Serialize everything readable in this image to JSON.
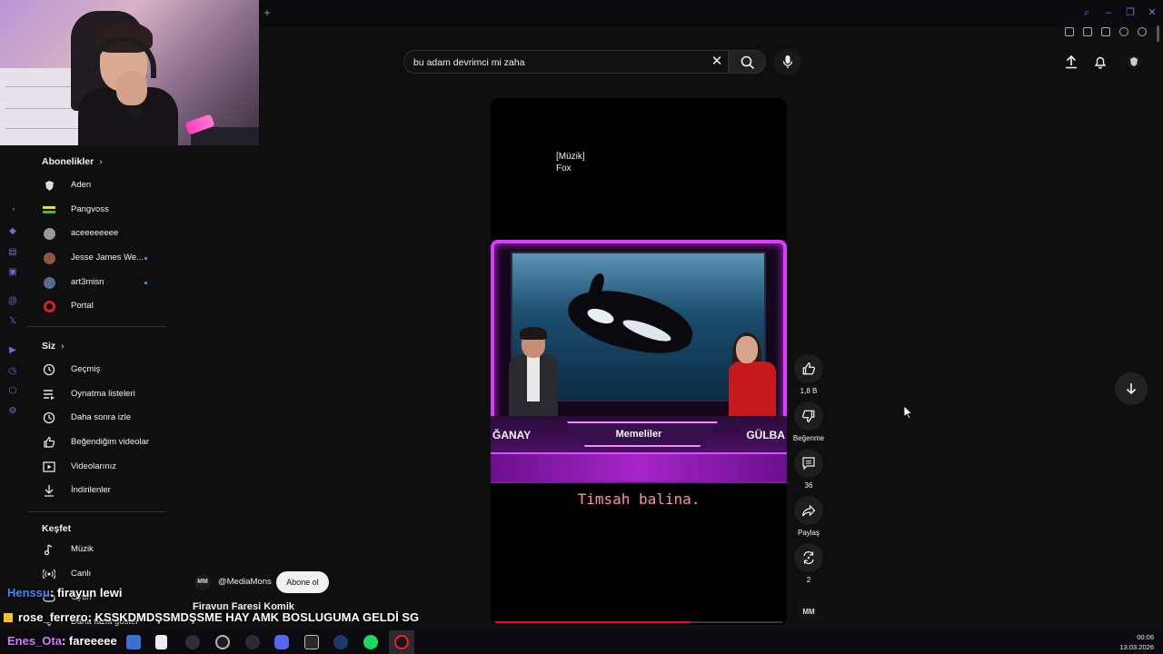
{
  "search": {
    "query": "bu adam devrimci mi zaha"
  },
  "sidebar": {
    "subscriptions_title": "Abonelikler",
    "subscriptions": [
      {
        "label": "Aden",
        "icon": "aden-avatar",
        "new": false
      },
      {
        "label": "Pangvoss",
        "icon": "pangvoss-avatar",
        "new": false
      },
      {
        "label": "aceeeeeeee",
        "icon": "aceeeeeeee-avatar",
        "new": false
      },
      {
        "label": "Jesse James We...",
        "icon": "jesse-avatar",
        "new": true
      },
      {
        "label": "art3misn",
        "icon": "art3misn-avatar",
        "new": true
      },
      {
        "label": "Portal",
        "icon": "portal-avatar",
        "new": false
      }
    ],
    "you_title": "Siz",
    "you_items": [
      {
        "label": "Geçmiş",
        "icon": "history-icon"
      },
      {
        "label": "Oynatma listeleri",
        "icon": "playlist-icon"
      },
      {
        "label": "Daha sonra izle",
        "icon": "clock-icon"
      },
      {
        "label": "Beğendiğim videolar",
        "icon": "thumbs-up-icon"
      },
      {
        "label": "Videolarınız",
        "icon": "video-icon"
      },
      {
        "label": "İndirilenler",
        "icon": "download-icon"
      }
    ],
    "explore_title": "Keşfet",
    "explore_items": [
      {
        "label": "Müzik",
        "icon": "music-icon"
      },
      {
        "label": "Canlı",
        "icon": "live-icon"
      },
      {
        "label": "Oyun",
        "icon": "gaming-icon"
      },
      {
        "label": "Daha fazla göster",
        "icon": "chevron-down-icon"
      }
    ]
  },
  "short": {
    "captions": "[Müzik]\nFox",
    "name_left": "ĞANAY",
    "name_center": "Memeliler",
    "name_right": "GÜLBA",
    "subtitle": "Timsah balina.",
    "progress": 0.68,
    "channel_handle": "@MediaMons",
    "channel_avatar_text": "MM",
    "subscribe_label": "Abone ol",
    "title": "Firavun Faresi Komik"
  },
  "actions": {
    "like_count": "1,8 B",
    "dislike_label": "Beğenme",
    "comment_count": "36",
    "share_label": "Paylaş",
    "remix_count": "2",
    "sound_thumb_text": "MM"
  },
  "chat": [
    {
      "user": "Henssu",
      "message": ": firayun lewi"
    },
    {
      "user": "rose_ferrero",
      "message": ": KSSKDMDŞSMDŞSME HAY AMK BOSLUGUMA GELDİ SG"
    },
    {
      "user": "Enes_Ota",
      "message": ": fareeeee"
    }
  ],
  "taskbar": {
    "time": "00:06",
    "date": "13.03.2026",
    "apps": [
      "file-explorer",
      "unity",
      "obs",
      "git",
      "discord",
      "epic-games",
      "steam",
      "spotify",
      "opera-gx"
    ]
  },
  "colors": {
    "background": "#0f0f0f",
    "accent_purple": "#8b6fe0",
    "progress_red": "#ff0033",
    "subtitle_pink": "#ff8fa6",
    "stage_magenta": "#d93dff"
  }
}
